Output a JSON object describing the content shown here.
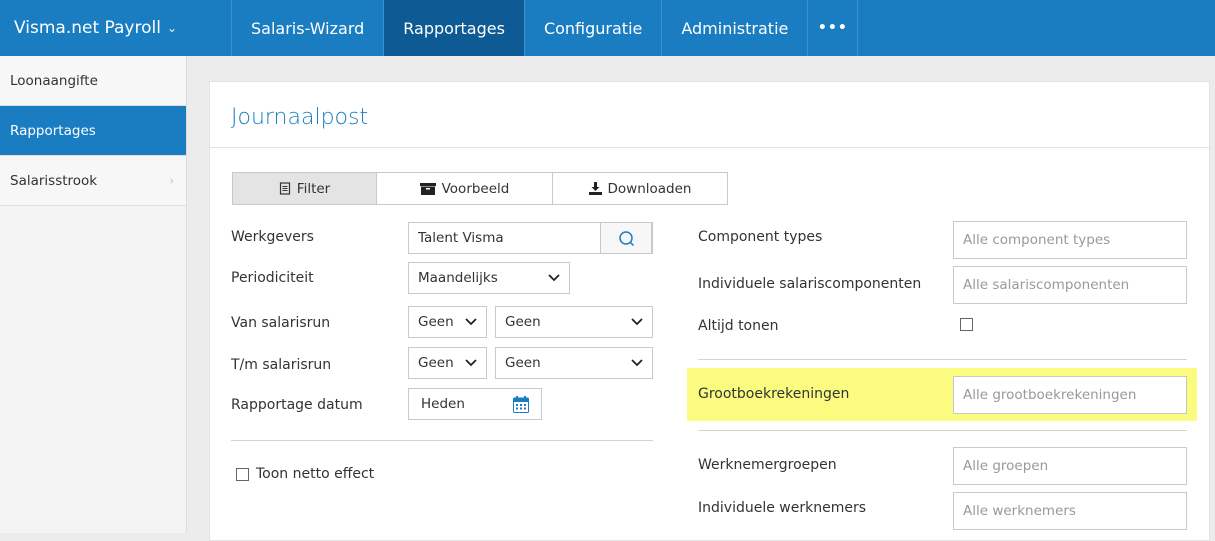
{
  "app": {
    "brand": "Visma.net Payroll"
  },
  "nav": {
    "items": [
      {
        "label": "Salaris-Wizard"
      },
      {
        "label": "Rapportages"
      },
      {
        "label": "Configuratie"
      },
      {
        "label": "Administratie"
      }
    ],
    "more_label": "•••"
  },
  "sidebar": {
    "items": [
      {
        "label": "Loonaangifte"
      },
      {
        "label": "Rapportages"
      },
      {
        "label": "Salarisstrook"
      }
    ]
  },
  "page": {
    "title": "Journaalpost"
  },
  "tabs": [
    {
      "label": "Filter"
    },
    {
      "label": "Voorbeeld"
    },
    {
      "label": "Downloaden"
    }
  ],
  "form_left": {
    "werkgevers_label": "Werkgevers",
    "werkgevers_value": "Talent  Visma",
    "periodiciteit_label": "Periodiciteit",
    "periodiciteit_value": "Maandelijks",
    "van_label": "Van salarisrun",
    "van_small": "Geen",
    "van_large": "Geen",
    "tm_label": "T/m salarisrun",
    "tm_small": "Geen",
    "tm_large": "Geen",
    "datum_label": "Rapportage datum",
    "datum_value": "Heden",
    "netto_label": "Toon netto effect"
  },
  "form_right": {
    "component_types_label": "Component types",
    "component_types_placeholder": "Alle component types",
    "salariscomponenten_label": "Individuele salariscomponenten",
    "salariscomponenten_placeholder": "Alle salariscomponenten",
    "altijd_label": "Altijd tonen",
    "grootboek_label": "Grootboekrekeningen",
    "grootboek_placeholder": "Alle grootboekrekeningen",
    "groepen_label": "Werknemergroepen",
    "groepen_placeholder": "Alle groepen",
    "werknemers_label": "Individuele werknemers",
    "werknemers_placeholder": "Alle werknemers"
  },
  "colors": {
    "accent": "#1a7dc1",
    "nav_active": "#0d5a94",
    "highlight": "#fbfb80"
  }
}
